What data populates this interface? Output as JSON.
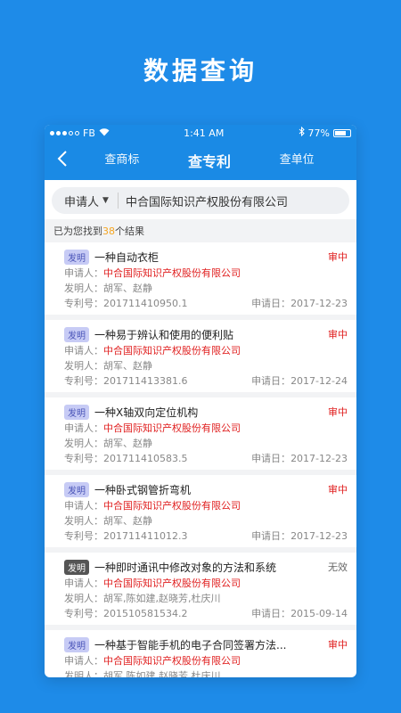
{
  "hero": {
    "title": "数据查询"
  },
  "status_bar": {
    "carrier": "FB",
    "time": "1:41 AM",
    "battery": "77%",
    "battery_level": 0.77
  },
  "nav": {
    "back_icon": "chevron-left-icon",
    "tabs": [
      {
        "label": "查商标",
        "active": false
      },
      {
        "label": "查专利",
        "active": true
      },
      {
        "label": "查单位",
        "active": false
      }
    ]
  },
  "search": {
    "filter_label": "申请人",
    "value": "中合国际知识产权股份有限公司"
  },
  "results": {
    "prefix": "已为您找到",
    "count": "38",
    "suffix": "个结果"
  },
  "labels": {
    "applicant": "申请人：",
    "inventor": "发明人：",
    "patent_no": "专利号：",
    "apply_date": "申请日："
  },
  "items": [
    {
      "badge": "发明",
      "badge_style": "light",
      "title": "一种自动衣柜",
      "status": "审中",
      "status_style": "red",
      "applicant": "中合国际知识产权股份有限公司",
      "inventor": "胡军、赵静",
      "patent_no": "201711410950.1",
      "date": "2017-12-23"
    },
    {
      "badge": "发明",
      "badge_style": "light",
      "title": "一种易于辨认和使用的便利贴",
      "status": "审中",
      "status_style": "red",
      "applicant": "中合国际知识产权股份有限公司",
      "inventor": "胡军、赵静",
      "patent_no": "201711413381.6",
      "date": "2017-12-24"
    },
    {
      "badge": "发明",
      "badge_style": "light",
      "title": "一种X轴双向定位机构",
      "status": "审中",
      "status_style": "red",
      "applicant": "中合国际知识产权股份有限公司",
      "inventor": "胡军、赵静",
      "patent_no": "201711410583.5",
      "date": "2017-12-23"
    },
    {
      "badge": "发明",
      "badge_style": "light",
      "title": "一种卧式钢管折弯机",
      "status": "审中",
      "status_style": "red",
      "applicant": "中合国际知识产权股份有限公司",
      "inventor": "胡军、赵静",
      "patent_no": "201711411012.3",
      "date": "2017-12-23"
    },
    {
      "badge": "发明",
      "badge_style": "dark",
      "title": "一种即时通讯中修改对象的方法和系统",
      "status": "无效",
      "status_style": "gray",
      "applicant": "中合国际知识产权股份有限公司",
      "inventor": "胡军,陈如建,赵晓芳,杜庆川",
      "patent_no": "201510581534.2",
      "date": "2015-09-14"
    },
    {
      "badge": "发明",
      "badge_style": "light",
      "title": "一种基于智能手机的电子合同签署方法...",
      "status": "审中",
      "status_style": "red",
      "applicant": "中合国际知识产权股份有限公司",
      "inventor": "胡军,陈如建,赵晓芳,杜庆川",
      "patent_no": "",
      "date": ""
    }
  ]
}
